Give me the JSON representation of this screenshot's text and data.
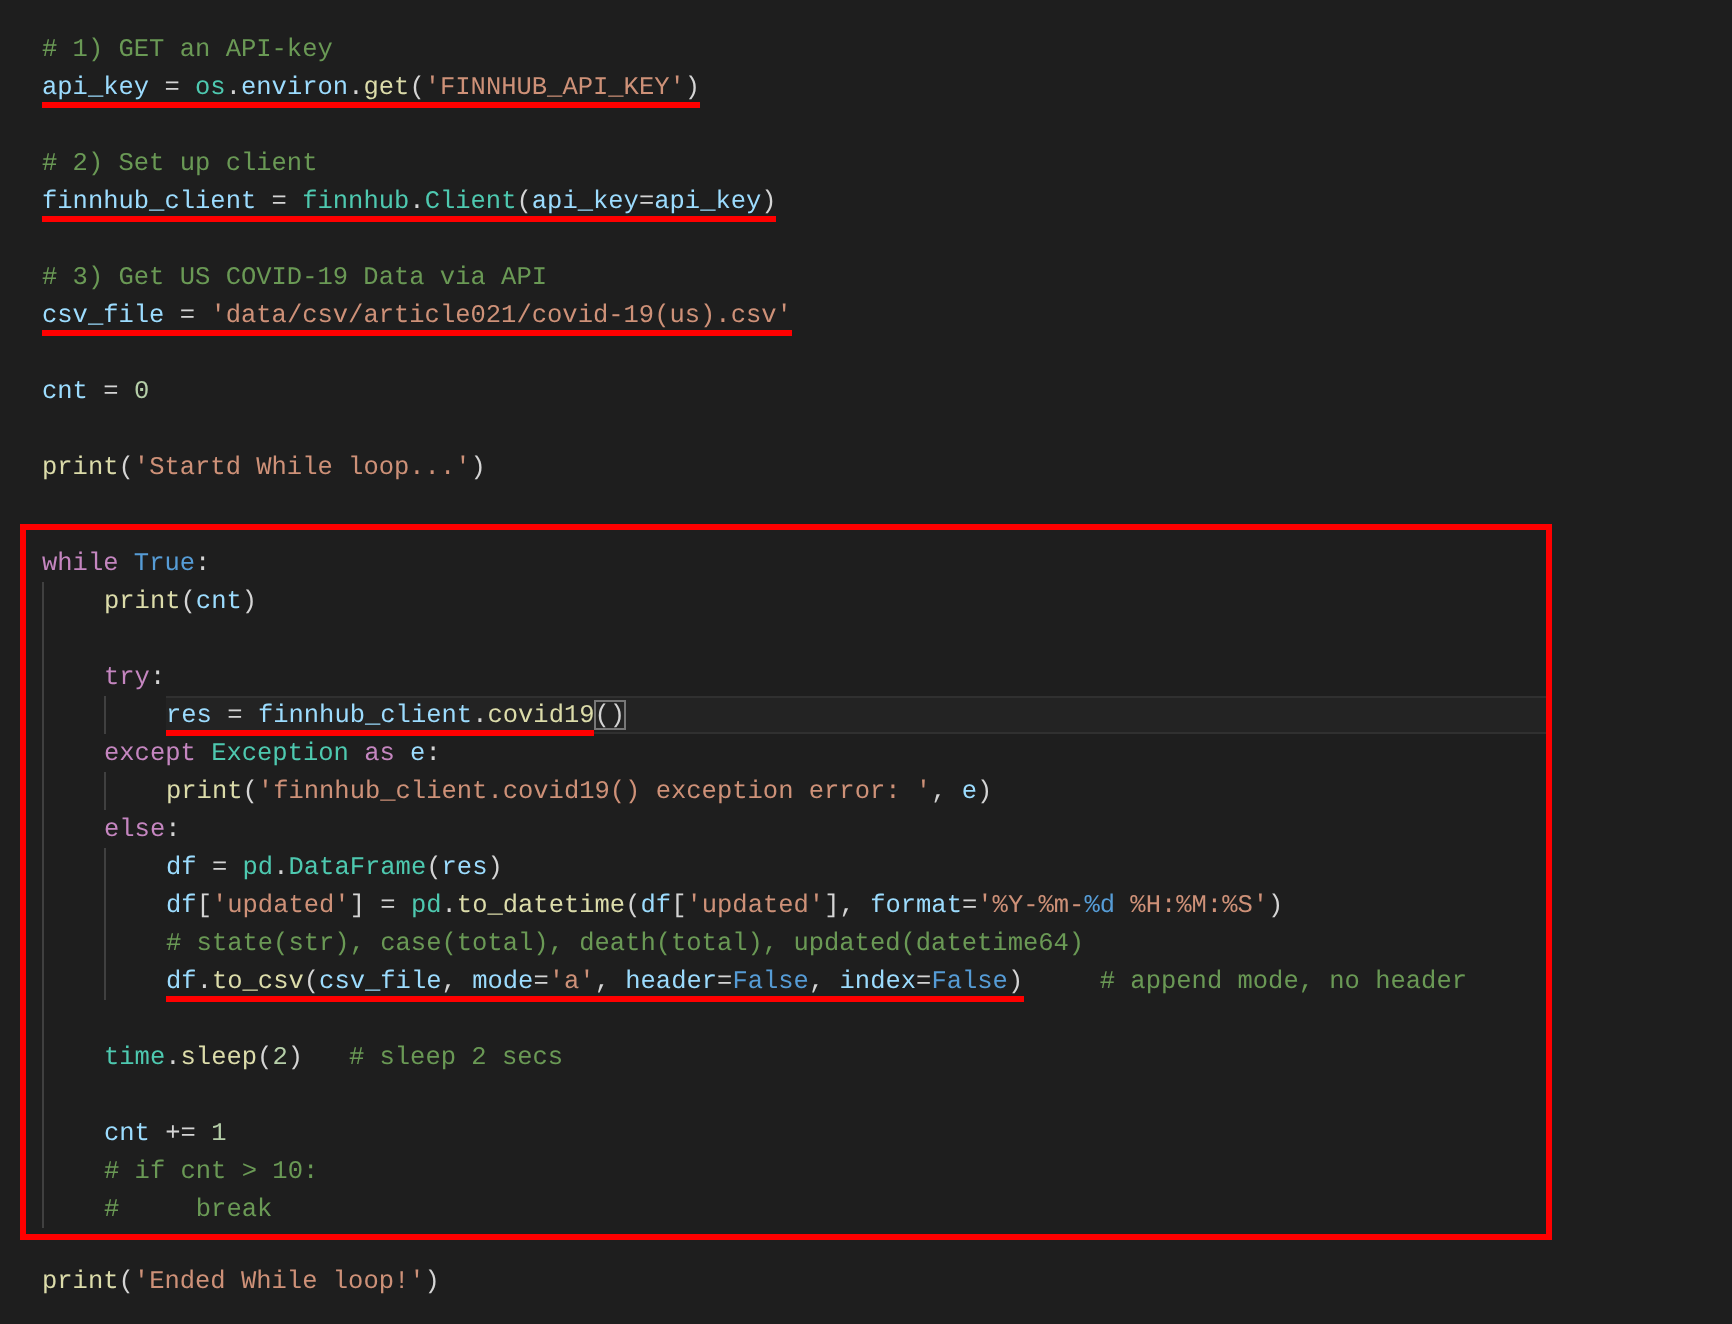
{
  "sections": [
    {
      "lines": [
        {
          "tokens": [
            {
              "kind": "comment",
              "text": "# 1) GET an API-key"
            }
          ]
        },
        {
          "underlined": true,
          "tokens": [
            {
              "kind": "var",
              "text": "api_key"
            },
            {
              "kind": "plain",
              "text": " = "
            },
            {
              "kind": "cls",
              "text": "os"
            },
            {
              "kind": "plain",
              "text": "."
            },
            {
              "kind": "var",
              "text": "environ"
            },
            {
              "kind": "plain",
              "text": "."
            },
            {
              "kind": "func",
              "text": "get"
            },
            {
              "kind": "plain",
              "text": "("
            },
            {
              "kind": "str",
              "text": "'FINNHUB_API_KEY'"
            },
            {
              "kind": "plain",
              "text": ")"
            }
          ]
        }
      ]
    },
    {
      "lines": [
        {
          "tokens": [
            {
              "kind": "comment",
              "text": "# 2) Set up client"
            }
          ]
        },
        {
          "underlined": true,
          "tokens": [
            {
              "kind": "var",
              "text": "finnhub_client"
            },
            {
              "kind": "plain",
              "text": " = "
            },
            {
              "kind": "cls",
              "text": "finnhub"
            },
            {
              "kind": "plain",
              "text": "."
            },
            {
              "kind": "cls",
              "text": "Client"
            },
            {
              "kind": "plain",
              "text": "("
            },
            {
              "kind": "var",
              "text": "api_key"
            },
            {
              "kind": "plain",
              "text": "="
            },
            {
              "kind": "var",
              "text": "api_key"
            },
            {
              "kind": "plain",
              "text": ")"
            }
          ]
        }
      ]
    },
    {
      "lines": [
        {
          "tokens": [
            {
              "kind": "comment",
              "text": "# 3) Get US COVID-19 Data via API"
            }
          ]
        },
        {
          "underlined": true,
          "tokens": [
            {
              "kind": "var",
              "text": "csv_file"
            },
            {
              "kind": "plain",
              "text": " = "
            },
            {
              "kind": "str",
              "text": "'data/csv/article021/covid-19(us).csv'"
            }
          ]
        }
      ]
    },
    {
      "lines": [
        {
          "tokens": [
            {
              "kind": "var",
              "text": "cnt"
            },
            {
              "kind": "plain",
              "text": " = "
            },
            {
              "kind": "num",
              "text": "0"
            }
          ]
        }
      ]
    },
    {
      "lines": [
        {
          "tokens": [
            {
              "kind": "func",
              "text": "print"
            },
            {
              "kind": "plain",
              "text": "("
            },
            {
              "kind": "str",
              "text": "'Startd While loop...'"
            },
            {
              "kind": "plain",
              "text": ")"
            }
          ]
        }
      ]
    },
    {
      "boxed": true,
      "lines": [
        {
          "tokens": [
            {
              "kind": "ctrl",
              "text": "while "
            },
            {
              "kind": "const",
              "text": "True"
            },
            {
              "kind": "plain",
              "text": ":"
            }
          ],
          "children": [
            {
              "lines": [
                {
                  "tokens": [
                    {
                      "kind": "func",
                      "text": "print"
                    },
                    {
                      "kind": "plain",
                      "text": "("
                    },
                    {
                      "kind": "var",
                      "text": "cnt"
                    },
                    {
                      "kind": "plain",
                      "text": ")"
                    }
                  ]
                }
              ]
            },
            {
              "lines": [
                {
                  "tokens": [
                    {
                      "kind": "ctrl",
                      "text": "try"
                    },
                    {
                      "kind": "plain",
                      "text": ":"
                    }
                  ],
                  "children": [
                    {
                      "lines": [
                        {
                          "underlined": true,
                          "current": true,
                          "tokens": [
                            {
                              "kind": "var",
                              "text": "res"
                            },
                            {
                              "kind": "plain",
                              "text": " = "
                            },
                            {
                              "kind": "var",
                              "text": "finnhub_client"
                            },
                            {
                              "kind": "plain",
                              "text": "."
                            },
                            {
                              "kind": "func",
                              "text": "covid19"
                            }
                          ],
                          "after": [
                            {
                              "kind": "plain",
                              "text": "()",
                              "matched": true
                            }
                          ]
                        }
                      ]
                    }
                  ]
                },
                {
                  "tokens": [
                    {
                      "kind": "ctrl",
                      "text": "except "
                    },
                    {
                      "kind": "cls",
                      "text": "Exception "
                    },
                    {
                      "kind": "ctrl",
                      "text": "as "
                    },
                    {
                      "kind": "var",
                      "text": "e"
                    },
                    {
                      "kind": "plain",
                      "text": ":"
                    }
                  ],
                  "children": [
                    {
                      "lines": [
                        {
                          "tokens": [
                            {
                              "kind": "func",
                              "text": "print"
                            },
                            {
                              "kind": "plain",
                              "text": "("
                            },
                            {
                              "kind": "str",
                              "text": "'finnhub_client.covid19() exception error: '"
                            },
                            {
                              "kind": "plain",
                              "text": ", "
                            },
                            {
                              "kind": "var",
                              "text": "e"
                            },
                            {
                              "kind": "plain",
                              "text": ")"
                            }
                          ]
                        }
                      ]
                    }
                  ]
                },
                {
                  "tokens": [
                    {
                      "kind": "ctrl",
                      "text": "else"
                    },
                    {
                      "kind": "plain",
                      "text": ":"
                    }
                  ],
                  "children": [
                    {
                      "lines": [
                        {
                          "tokens": [
                            {
                              "kind": "var",
                              "text": "df"
                            },
                            {
                              "kind": "plain",
                              "text": " = "
                            },
                            {
                              "kind": "cls",
                              "text": "pd"
                            },
                            {
                              "kind": "plain",
                              "text": "."
                            },
                            {
                              "kind": "cls",
                              "text": "DataFrame"
                            },
                            {
                              "kind": "plain",
                              "text": "("
                            },
                            {
                              "kind": "var",
                              "text": "res"
                            },
                            {
                              "kind": "plain",
                              "text": ")"
                            }
                          ]
                        },
                        {
                          "tokens": [
                            {
                              "kind": "var",
                              "text": "df"
                            },
                            {
                              "kind": "plain",
                              "text": "["
                            },
                            {
                              "kind": "str",
                              "text": "'updated'"
                            },
                            {
                              "kind": "plain",
                              "text": "] = "
                            },
                            {
                              "kind": "cls",
                              "text": "pd"
                            },
                            {
                              "kind": "plain",
                              "text": "."
                            },
                            {
                              "kind": "func",
                              "text": "to_datetime"
                            },
                            {
                              "kind": "plain",
                              "text": "("
                            },
                            {
                              "kind": "var",
                              "text": "df"
                            },
                            {
                              "kind": "plain",
                              "text": "["
                            },
                            {
                              "kind": "str",
                              "text": "'updated'"
                            },
                            {
                              "kind": "plain",
                              "text": "], "
                            },
                            {
                              "kind": "var",
                              "text": "format"
                            },
                            {
                              "kind": "plain",
                              "text": "="
                            },
                            {
                              "kind": "str",
                              "text": "'%Y-%m-"
                            },
                            {
                              "kind": "const",
                              "text": "%d"
                            },
                            {
                              "kind": "str",
                              "text": " %H:%M:%S'"
                            },
                            {
                              "kind": "plain",
                              "text": ")"
                            }
                          ]
                        },
                        {
                          "tokens": [
                            {
                              "kind": "comment",
                              "text": "# state(str), case(total), death(total), updated(datetime64)"
                            }
                          ]
                        },
                        {
                          "underlined": true,
                          "tokens": [
                            {
                              "kind": "var",
                              "text": "df"
                            },
                            {
                              "kind": "plain",
                              "text": "."
                            },
                            {
                              "kind": "func",
                              "text": "to_csv"
                            },
                            {
                              "kind": "plain",
                              "text": "("
                            },
                            {
                              "kind": "var",
                              "text": "csv_file"
                            },
                            {
                              "kind": "plain",
                              "text": ", "
                            },
                            {
                              "kind": "var",
                              "text": "mode"
                            },
                            {
                              "kind": "plain",
                              "text": "="
                            },
                            {
                              "kind": "str",
                              "text": "'a'"
                            },
                            {
                              "kind": "plain",
                              "text": ", "
                            },
                            {
                              "kind": "var",
                              "text": "header"
                            },
                            {
                              "kind": "plain",
                              "text": "="
                            },
                            {
                              "kind": "const",
                              "text": "False"
                            },
                            {
                              "kind": "plain",
                              "text": ", "
                            },
                            {
                              "kind": "var",
                              "text": "index"
                            },
                            {
                              "kind": "plain",
                              "text": "="
                            },
                            {
                              "kind": "const",
                              "text": "False"
                            },
                            {
                              "kind": "plain",
                              "text": ")"
                            }
                          ],
                          "after": [
                            {
                              "kind": "comment",
                              "text": "     # append mode, no header"
                            }
                          ]
                        }
                      ]
                    }
                  ]
                }
              ]
            },
            {
              "lines": [
                {
                  "tokens": [
                    {
                      "kind": "cls",
                      "text": "time"
                    },
                    {
                      "kind": "plain",
                      "text": "."
                    },
                    {
                      "kind": "func",
                      "text": "sleep"
                    },
                    {
                      "kind": "plain",
                      "text": "("
                    },
                    {
                      "kind": "num",
                      "text": "2"
                    },
                    {
                      "kind": "plain",
                      "text": ")   "
                    },
                    {
                      "kind": "comment",
                      "text": "# sleep 2 secs"
                    }
                  ]
                }
              ]
            },
            {
              "lines": [
                {
                  "tokens": [
                    {
                      "kind": "var",
                      "text": "cnt"
                    },
                    {
                      "kind": "plain",
                      "text": " += "
                    },
                    {
                      "kind": "num",
                      "text": "1"
                    }
                  ]
                },
                {
                  "tokens": [
                    {
                      "kind": "comment",
                      "text": "# if cnt > 10:"
                    }
                  ]
                },
                {
                  "tokens": [
                    {
                      "kind": "comment",
                      "text": "#     break"
                    }
                  ]
                }
              ]
            }
          ]
        }
      ]
    },
    {
      "lines": [
        {
          "tokens": [
            {
              "kind": "func",
              "text": "print"
            },
            {
              "kind": "plain",
              "text": "("
            },
            {
              "kind": "str",
              "text": "'Ended While loop!'"
            },
            {
              "kind": "plain",
              "text": ")"
            }
          ]
        }
      ]
    }
  ]
}
